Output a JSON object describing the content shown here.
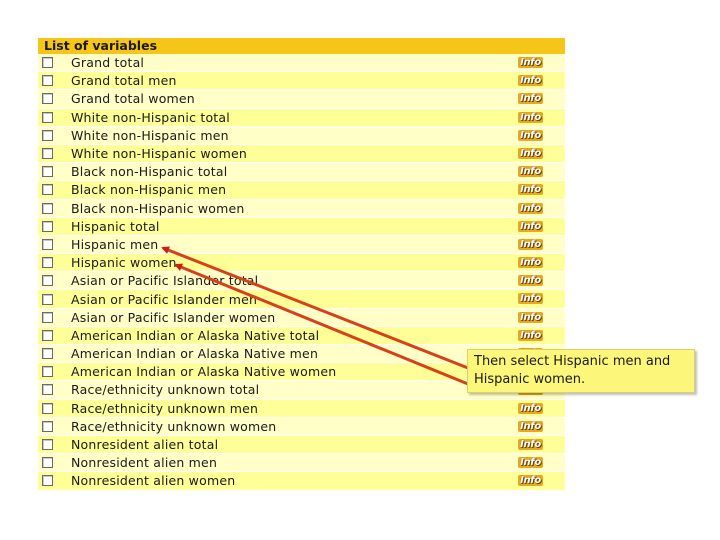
{
  "panel": {
    "title": "List of variables",
    "info_label": "Info",
    "variables": [
      "Grand total",
      "Grand total men",
      "Grand total women",
      "White non-Hispanic total",
      "White non-Hispanic men",
      "White non-Hispanic women",
      "Black non-Hispanic total",
      "Black non-Hispanic men",
      "Black non-Hispanic women",
      "Hispanic total",
      "Hispanic men",
      "Hispanic women",
      "Asian or Pacific Islander total",
      "Asian or Pacific Islander men",
      "Asian or Pacific Islander women",
      "American Indian or Alaska Native total",
      "American Indian or Alaska Native men",
      "American Indian or Alaska Native women",
      "Race/ethnicity unknown total",
      "Race/ethnicity unknown men",
      "Race/ethnicity unknown women",
      "Nonresident alien total",
      "Nonresident alien men",
      "Nonresident alien women"
    ]
  },
  "callout": {
    "text": "Then select Hispanic men and Hispanic women."
  },
  "colors": {
    "header_bg": "#f5c518",
    "row_light": "#ffffc7",
    "row_dark": "#ffff98",
    "info_button": "#e7a81c",
    "callout_bg": "#fcf67a",
    "arrow": "#cc1e12"
  }
}
